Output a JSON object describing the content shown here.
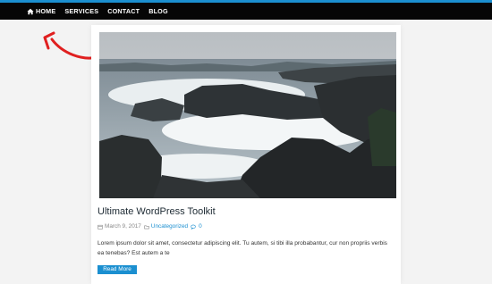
{
  "nav": {
    "items": [
      {
        "label": "HOME",
        "icon": "home-icon"
      },
      {
        "label": "SERVICES"
      },
      {
        "label": "CONTACT"
      },
      {
        "label": "BLOG"
      }
    ]
  },
  "post": {
    "title": "Ultimate WordPress Toolkit",
    "date": "March 9, 2017",
    "category": "Uncategorized",
    "comment_count": "0",
    "excerpt": "Lorem ipsum dolor sit amet, consectetur adipiscing elit. Tu autem, si tibi illa probabantur, cur non propriis verbis ea tenebas? Est autem a te",
    "read_more": "Read More"
  },
  "colors": {
    "accent": "#1b8fd0",
    "navbar": "#060606",
    "annotation": "#e02020"
  }
}
